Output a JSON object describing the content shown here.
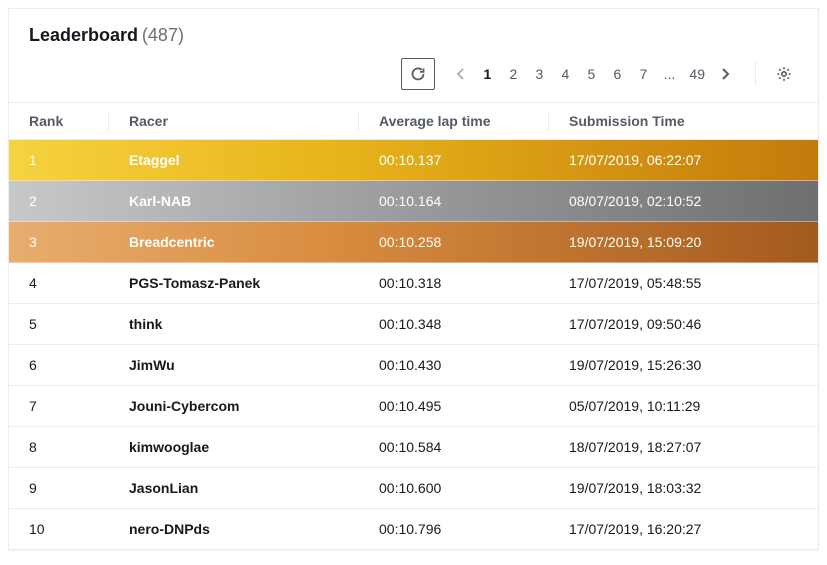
{
  "header": {
    "title": "Leaderboard",
    "count": "(487)"
  },
  "pagination": {
    "pages": [
      "1",
      "2",
      "3",
      "4",
      "5",
      "6",
      "7",
      "...",
      "49"
    ],
    "current": "1"
  },
  "columns": {
    "rank": "Rank",
    "racer": "Racer",
    "lap": "Average lap time",
    "submitted": "Submission Time"
  },
  "rows": [
    {
      "rank": "1",
      "racer": "Etaggel",
      "lap": "00:10.137",
      "submitted": "17/07/2019, 06:22:07",
      "medal": "gold"
    },
    {
      "rank": "2",
      "racer": "Karl-NAB",
      "lap": "00:10.164",
      "submitted": "08/07/2019, 02:10:52",
      "medal": "silver"
    },
    {
      "rank": "3",
      "racer": "Breadcentric",
      "lap": "00:10.258",
      "submitted": "19/07/2019, 15:09:20",
      "medal": "bronze"
    },
    {
      "rank": "4",
      "racer": "PGS-Tomasz-Panek",
      "lap": "00:10.318",
      "submitted": "17/07/2019, 05:48:55",
      "medal": null
    },
    {
      "rank": "5",
      "racer": "think",
      "lap": "00:10.348",
      "submitted": "17/07/2019, 09:50:46",
      "medal": null
    },
    {
      "rank": "6",
      "racer": "JimWu",
      "lap": "00:10.430",
      "submitted": "19/07/2019, 15:26:30",
      "medal": null
    },
    {
      "rank": "7",
      "racer": "Jouni-Cybercom",
      "lap": "00:10.495",
      "submitted": "05/07/2019, 10:11:29",
      "medal": null
    },
    {
      "rank": "8",
      "racer": "kimwooglae",
      "lap": "00:10.584",
      "submitted": "18/07/2019, 18:27:07",
      "medal": null
    },
    {
      "rank": "9",
      "racer": "JasonLian",
      "lap": "00:10.600",
      "submitted": "19/07/2019, 18:03:32",
      "medal": null
    },
    {
      "rank": "10",
      "racer": "nero-DNPds",
      "lap": "00:10.796",
      "submitted": "17/07/2019, 16:20:27",
      "medal": null
    }
  ]
}
